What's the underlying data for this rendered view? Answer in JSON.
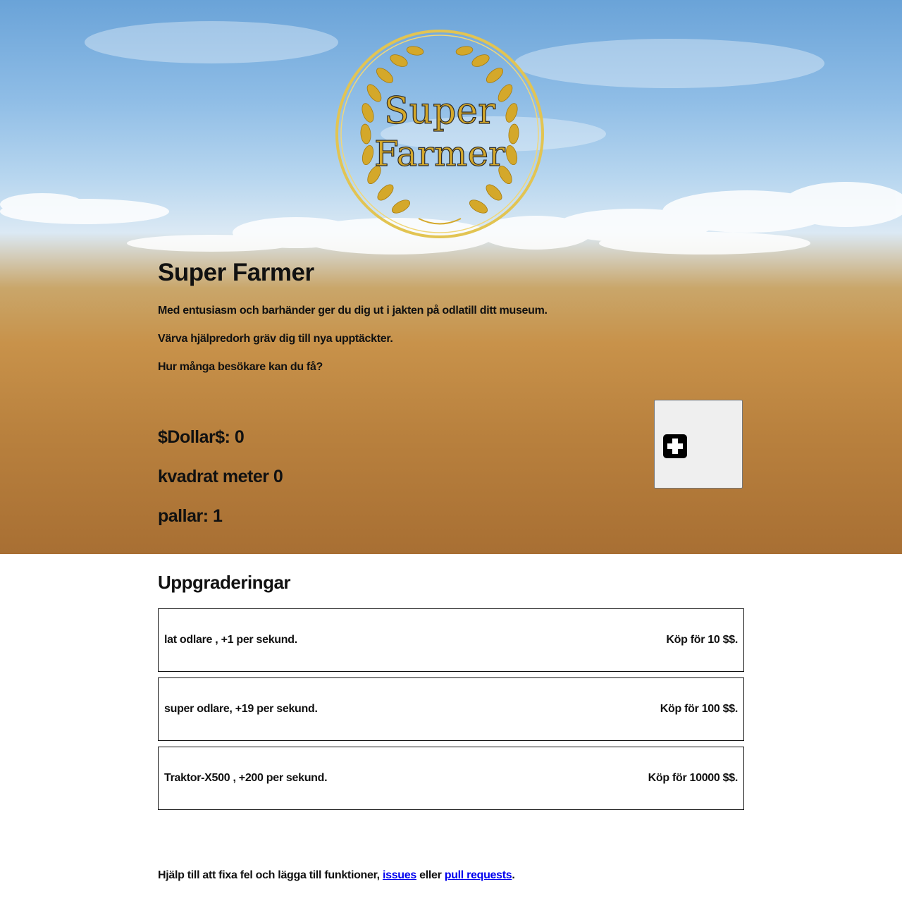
{
  "logo": {
    "line1": "Super",
    "line2": "Farmer"
  },
  "hero": {
    "title": "Super Farmer",
    "descriptions": [
      "Med entusiasm och barhänder ger du dig ut i jakten på odlatill ditt museum.",
      "Värva hjälpredorh gräv dig till nya upptäckter.",
      "Hur många besökare kan du få?"
    ],
    "stats": {
      "dollars": "$Dollar$: 0",
      "area": "kvadrat meter 0",
      "pallets": "pallar: 1"
    },
    "clicker_icon": "plus-square-icon"
  },
  "upgrades": {
    "title": "Uppgraderingar",
    "items": [
      {
        "name": "lat odlare , +1 per sekund.",
        "price": "Köp för 10 $$."
      },
      {
        "name": "super odlare, +19 per sekund.",
        "price": "Köp för 100 $$."
      },
      {
        "name": "Traktor-X500 , +200 per sekund.",
        "price": "Köp för 10000 $$."
      }
    ]
  },
  "footer": {
    "text_before": "Hjälp till att fixa fel och lägga till funktioner, ",
    "link1": "issues",
    "text_middle": " eller ",
    "link2": "pull requests",
    "text_after": "."
  },
  "colors": {
    "link": "#0000ee",
    "gold": "#d4a82a",
    "text": "#111111"
  }
}
